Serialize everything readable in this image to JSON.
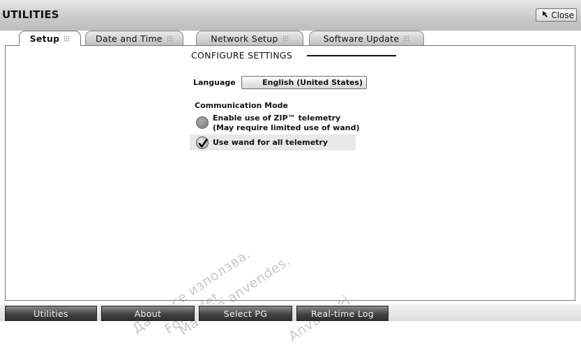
{
  "window": {
    "title": "UTILITIES",
    "close_label": "Close"
  },
  "tabs": [
    {
      "label": "Setup",
      "active": true
    },
    {
      "label": "Date and Time",
      "active": false
    },
    {
      "label": "Network Setup",
      "active": false
    },
    {
      "label": "Software Update",
      "active": false
    }
  ],
  "setup": {
    "section_title": "CONFIGURE SETTINGS",
    "language_label": "Language",
    "language_value": "English (United States)",
    "communication_mode_label": "Communication Mode",
    "options": [
      {
        "line1": "Enable use of ZIP™ telemetry",
        "line2": "(May require limited use of wand)",
        "selected": false
      },
      {
        "line1": "Use wand for all telemetry",
        "selected": true
      }
    ]
  },
  "watermark": [
    "Да не се използва.",
    "Forældet.",
    "Må ikke anvendes.",
    "Använd ej."
  ],
  "bottom_nav": [
    {
      "label": "Utilities"
    },
    {
      "label": "About"
    },
    {
      "label": "Select PG"
    },
    {
      "label": "Real-time Log"
    }
  ],
  "colors": {
    "title_bar": "#c9c9c9",
    "bottom_button": "#444444",
    "selected_row": "#e8e8e8"
  },
  "icons": {
    "close": "arrow-pointer-icon",
    "tab_grip": "grip-dots-icon",
    "check": "checkmark-icon"
  }
}
